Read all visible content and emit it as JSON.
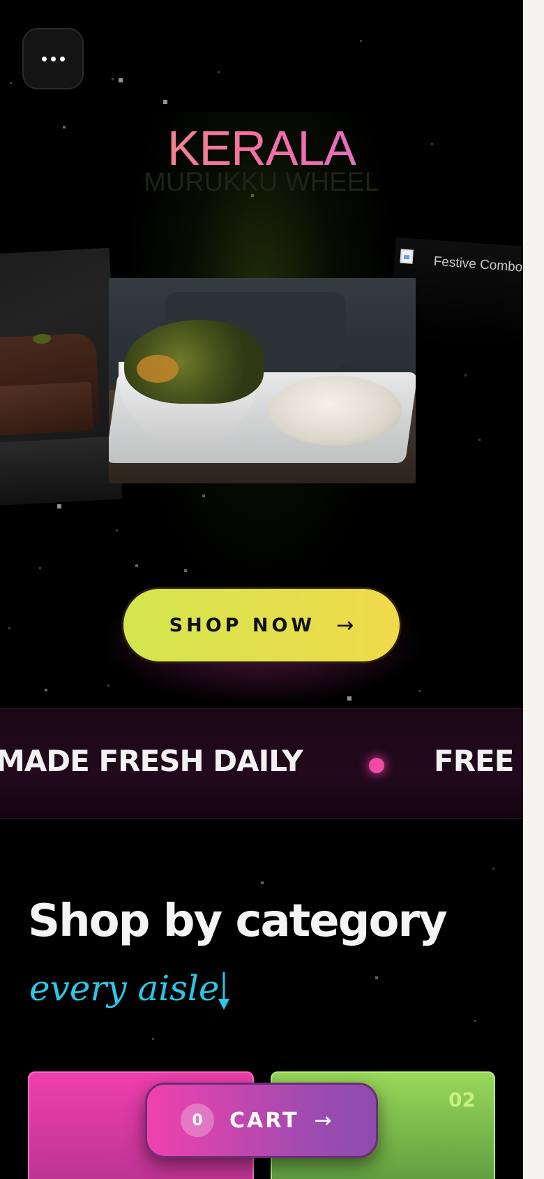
{
  "menu": {
    "icon": "more-horizontal-icon"
  },
  "hero": {
    "title": "KERALA",
    "subtitle": "MURUKKU WHEEL",
    "side_card_right_label": "Festive Combo",
    "shop_button_label": "SHOP NOW",
    "shop_button_arrow": "→"
  },
  "marquee": {
    "items": [
      "MADE FRESH DAILY",
      "FREE"
    ]
  },
  "categories": {
    "title": "Shop by category",
    "subtitle": "every aisle",
    "cards": [
      {
        "number": ""
      },
      {
        "number": "02"
      }
    ]
  },
  "cart": {
    "count": "0",
    "label": "CART",
    "arrow": "→"
  },
  "colors": {
    "accent_pink": "#f241ad",
    "accent_lime": "#d3e64e",
    "accent_cyan": "#29c7e8",
    "accent_green": "#98d85a"
  }
}
